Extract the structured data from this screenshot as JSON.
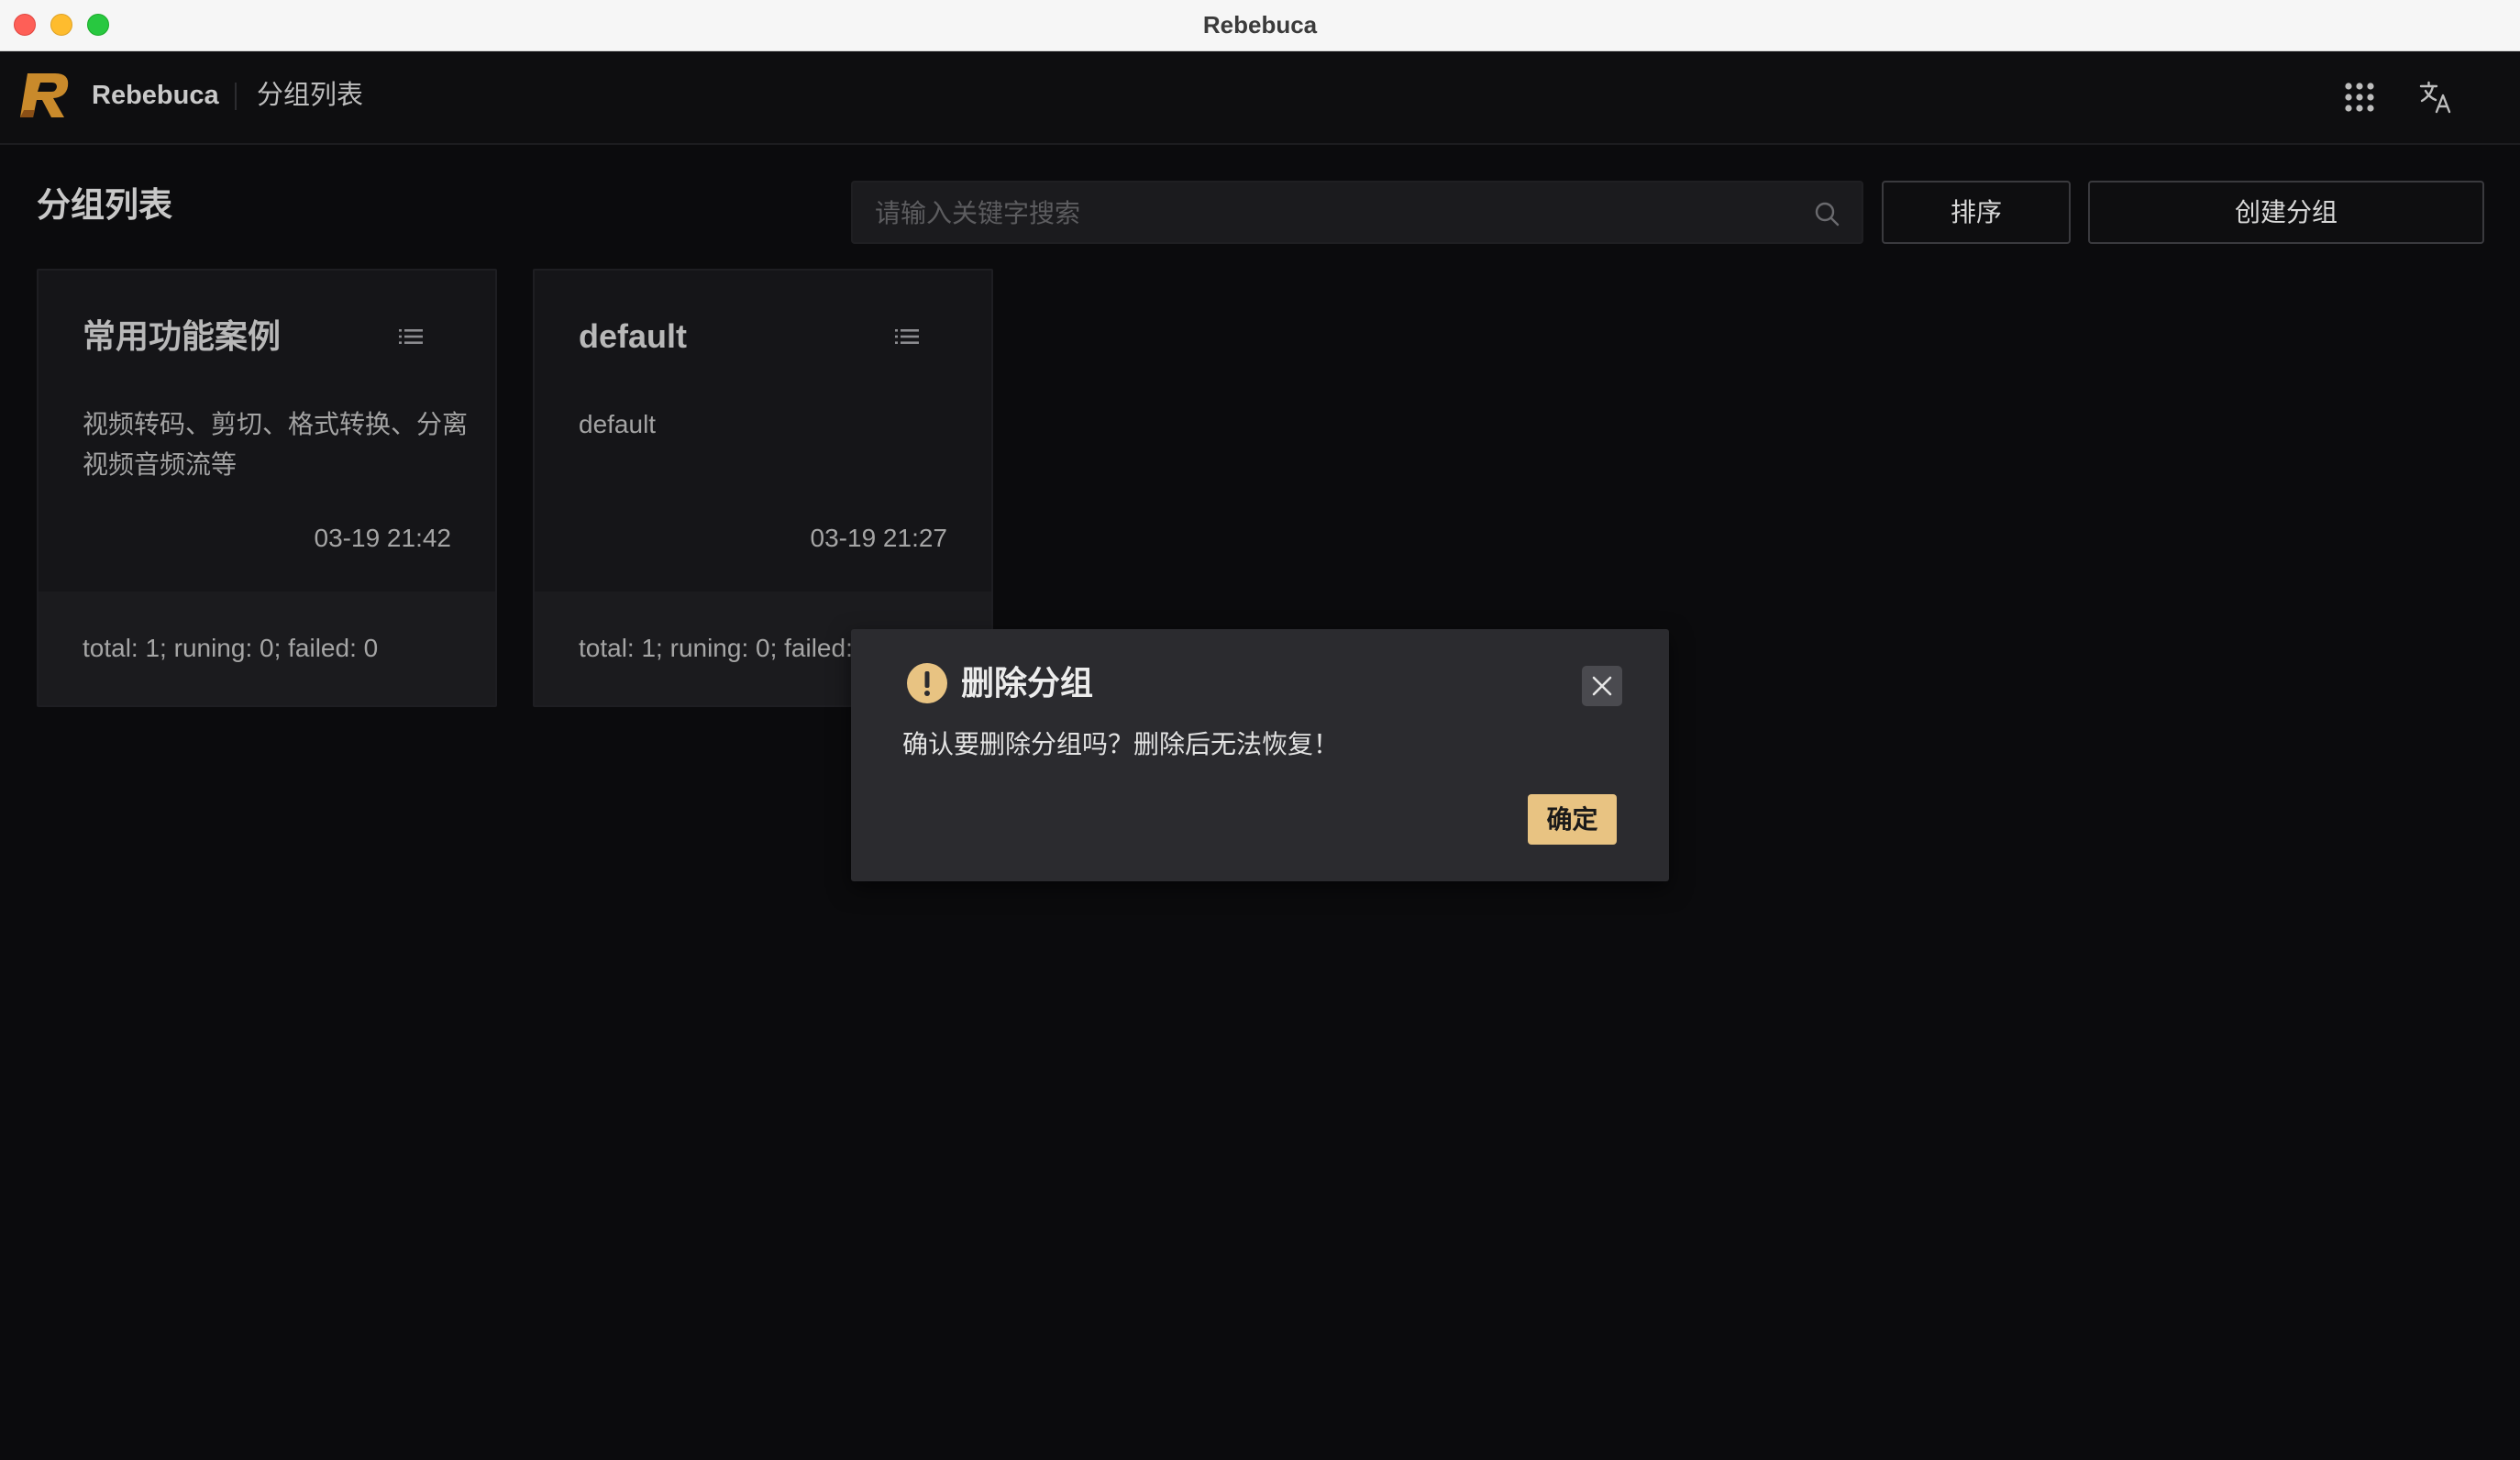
{
  "window": {
    "title": "Rebebuca",
    "traffic_lights": [
      "close",
      "minimize",
      "zoom"
    ]
  },
  "header": {
    "app_name": "Rebebuca",
    "breadcrumb": "分组列表",
    "icons": [
      "apps-grid-icon",
      "translate-icon"
    ],
    "logo_colors": [
      "#c98a2b",
      "#8a4f16"
    ]
  },
  "page": {
    "title": "分组列表",
    "search": {
      "placeholder": "请输入关键字搜索",
      "value": ""
    },
    "sort_label": "排序",
    "create_label": "创建分组"
  },
  "groups": [
    {
      "title": "常用功能案例",
      "description": "视频转码、剪切、格式转换、分离视频音频流等",
      "time": "03-19 21:42",
      "stats": "total: 1; runing: 0; failed: 0"
    },
    {
      "title": "default",
      "description": "default",
      "time": "03-19 21:27",
      "stats": "total: 1; runing: 0; failed: 0"
    }
  ],
  "modal": {
    "title": "删除分组",
    "message": "确认要删除分组吗？删除后无法恢复！",
    "confirm_label": "确定",
    "warn_color": "#e8c382"
  },
  "colors": {
    "accent": "#e8c382",
    "background": "#0b0b0d",
    "card": "#151518",
    "modal": "#2b2b2f"
  }
}
